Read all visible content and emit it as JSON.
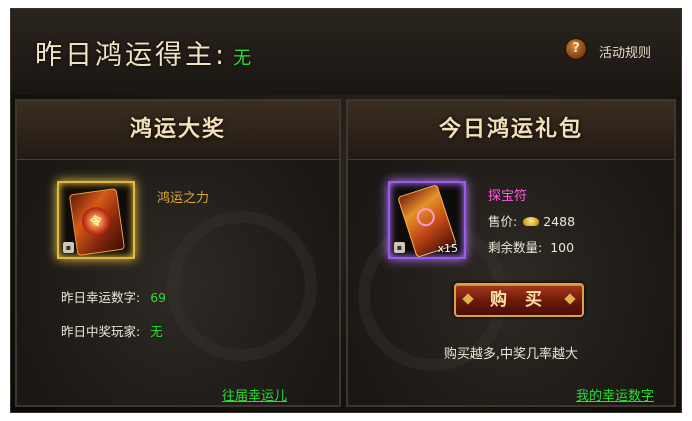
{
  "header": {
    "title": "昨日鸿运得主:",
    "winner": "无",
    "help_symbol": "?",
    "rules_label": "活动规则"
  },
  "left_panel": {
    "title": "鸿运大奖",
    "item": {
      "name": "鸿运之力",
      "icon": "card-icon",
      "lock_icon": "lock-icon"
    },
    "lucky_number_label": "昨日幸运数字:",
    "lucky_number_value": "69",
    "winner_label": "昨日中奖玩家:",
    "winner_value": "无",
    "history_link": "往届幸运儿"
  },
  "right_panel": {
    "title": "今日鸿运礼包",
    "item": {
      "name": "探宝符",
      "icon": "scroll-icon",
      "quantity": "x15",
      "lock_icon": "lock-icon"
    },
    "price_label": "售价:",
    "currency_icon": "gold-ingot-icon",
    "price_value": "2488",
    "remaining_label": "剩余数量:",
    "remaining_value": "100",
    "buy_label": "购 买",
    "hint": "购买越多,中奖几率越大",
    "my_numbers_link": "我的幸运数字"
  },
  "colors": {
    "accent_green": "#27e034",
    "gold": "#e3a835",
    "pink": "#ff5ae4",
    "title_text": "#f4dfb8"
  }
}
